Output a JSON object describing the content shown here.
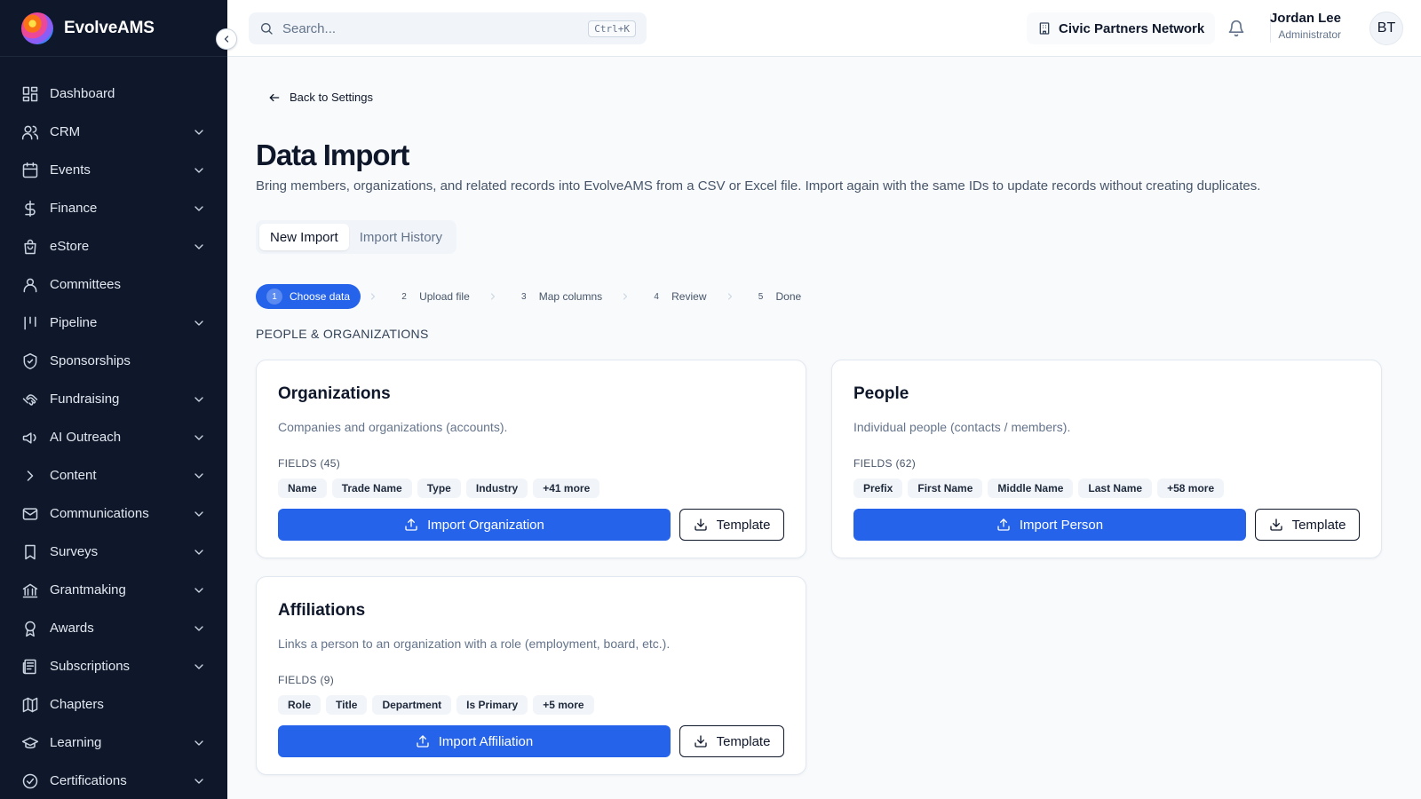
{
  "brand": {
    "name": "EvolveAMS"
  },
  "sidebar": {
    "items": [
      {
        "label": "Dashboard",
        "icon": "dashboard-icon",
        "expandable": false
      },
      {
        "label": "CRM",
        "icon": "users-icon",
        "expandable": true
      },
      {
        "label": "Events",
        "icon": "calendar-icon",
        "expandable": true
      },
      {
        "label": "Finance",
        "icon": "dollar-icon",
        "expandable": true
      },
      {
        "label": "eStore",
        "icon": "store-icon",
        "expandable": true
      },
      {
        "label": "Committees",
        "icon": "user-icon",
        "expandable": false
      },
      {
        "label": "Pipeline",
        "icon": "pipeline-icon",
        "expandable": true
      },
      {
        "label": "Sponsorships",
        "icon": "badge-icon",
        "expandable": false
      },
      {
        "label": "Fundraising",
        "icon": "handshake-icon",
        "expandable": true
      },
      {
        "label": "AI Outreach",
        "icon": "megaphone-icon",
        "expandable": true
      },
      {
        "label": "Content",
        "icon": "chevron-right-icon",
        "expandable": true
      },
      {
        "label": "Communications",
        "icon": "mail-icon",
        "expandable": true
      },
      {
        "label": "Surveys",
        "icon": "bookmark-icon",
        "expandable": true
      },
      {
        "label": "Grantmaking",
        "icon": "bank-icon",
        "expandable": true
      },
      {
        "label": "Awards",
        "icon": "award-icon",
        "expandable": true
      },
      {
        "label": "Subscriptions",
        "icon": "newspaper-icon",
        "expandable": true
      },
      {
        "label": "Chapters",
        "icon": "map-icon",
        "expandable": false
      },
      {
        "label": "Learning",
        "icon": "graduation-cap-icon",
        "expandable": true
      },
      {
        "label": "Certifications",
        "icon": "check-circle-icon",
        "expandable": true
      }
    ]
  },
  "topbar": {
    "search_placeholder": "Search...",
    "shortcut": "Ctrl+K",
    "organization": "Civic Partners Network",
    "user_name": "Jordan Lee",
    "user_role": "Administrator",
    "avatar_initials": "BT"
  },
  "page": {
    "back_label": "Back to Settings",
    "title": "Data Import",
    "description": "Bring members, organizations, and related records into EvolveAMS from a CSV or Excel file. Import again with the same IDs to update records without creating duplicates.",
    "tabs": [
      "New Import",
      "Import History"
    ],
    "active_tab": "New Import",
    "steps": [
      {
        "num": "1",
        "label": "Choose data"
      },
      {
        "num": "2",
        "label": "Upload file"
      },
      {
        "num": "3",
        "label": "Map columns"
      },
      {
        "num": "4",
        "label": "Review"
      },
      {
        "num": "5",
        "label": "Done"
      }
    ],
    "active_step": "1",
    "section_label": "PEOPLE & ORGANIZATIONS"
  },
  "cards": {
    "organizations": {
      "title": "Organizations",
      "description": "Companies and organizations (accounts).",
      "fields_label": "FIELDS (45)",
      "chips": [
        "Name",
        "Trade Name",
        "Type",
        "Industry",
        "+41 more"
      ],
      "import_label": "Import Organization",
      "template_label": "Template"
    },
    "people": {
      "title": "People",
      "description": "Individual people (contacts / members).",
      "fields_label": "FIELDS (62)",
      "chips": [
        "Prefix",
        "First Name",
        "Middle Name",
        "Last Name",
        "+58 more"
      ],
      "import_label": "Import Person",
      "template_label": "Template"
    },
    "affiliations": {
      "title": "Affiliations",
      "description": "Links a person to an organization with a role (employment, board, etc.).",
      "fields_label": "FIELDS (9)",
      "chips": [
        "Role",
        "Title",
        "Department",
        "Is Primary",
        "+5 more"
      ],
      "import_label": "Import Affiliation",
      "template_label": "Template"
    }
  },
  "colors": {
    "accent": "#2563eb",
    "sidebar_bg": "#0f172a"
  }
}
